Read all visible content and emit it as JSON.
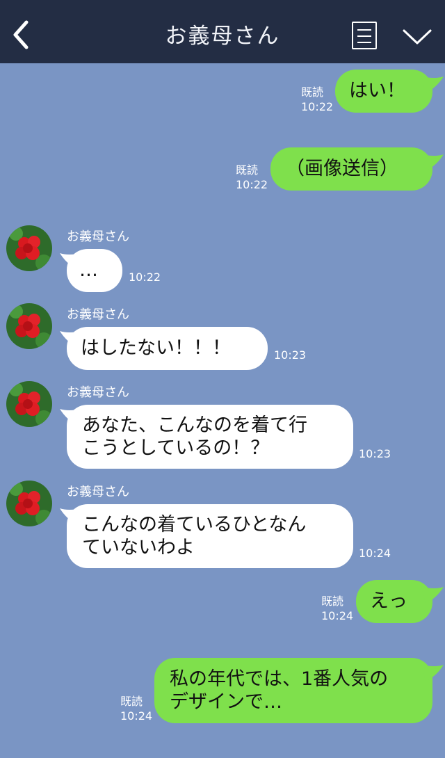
{
  "header": {
    "title": "お義母さん"
  },
  "messages": [
    {
      "side": "me",
      "text": "はい！",
      "read": "既読",
      "time": "10:22"
    },
    {
      "side": "me",
      "text": "（画像送信）",
      "read": "既読",
      "time": "10:22"
    },
    {
      "side": "them",
      "sender": "お義母さん",
      "text": "…",
      "time": "10:22"
    },
    {
      "side": "them",
      "sender": "お義母さん",
      "text": "はしたない！！！",
      "time": "10:23"
    },
    {
      "side": "them",
      "sender": "お義母さん",
      "line1": "あなた、こんなのを着て行",
      "line2": "こうとしているの！？",
      "time": "10:23"
    },
    {
      "side": "them",
      "sender": "お義母さん",
      "line1": "こんなの着ているひとなん",
      "line2": "ていないわよ",
      "time": "10:24"
    },
    {
      "side": "me",
      "text": "えっ",
      "read": "既読",
      "time": "10:24"
    },
    {
      "side": "me",
      "line1": "私の年代では、1番人気の",
      "line2": "デザインで…",
      "read": "既読",
      "time": "10:24"
    }
  ],
  "colors": {
    "header_bg": "#232d44",
    "chat_bg": "#7a95c4",
    "my_bubble": "#7fe04c",
    "their_bubble": "#ffffff"
  },
  "icons": [
    "back-icon",
    "menu-icon",
    "chevron-down-icon",
    "avatar-flower-icon"
  ]
}
